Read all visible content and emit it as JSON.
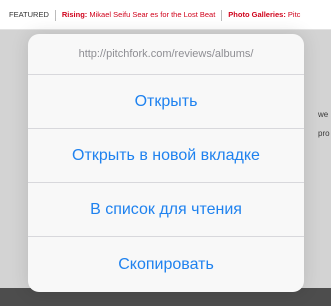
{
  "background": {
    "featured_label": "FEATURED",
    "rising_label": "Rising:",
    "rising_story": "Mikael Seifu Sear  es for the Lost Beat",
    "galleries_label": "Photo Galleries:",
    "galleries_story": "Pitc",
    "snippet_1": "we",
    "snippet_2": "pro"
  },
  "sheet": {
    "url": "http://pitchfork.com/reviews/albums/",
    "actions": [
      {
        "label": "Открыть"
      },
      {
        "label": "Открыть в новой вкладке"
      },
      {
        "label": "В список для чтения"
      },
      {
        "label": "Скопировать"
      }
    ]
  },
  "colors": {
    "accent": "#1f82ef",
    "header_text": "#8e8e93",
    "featured_red": "#d0021b"
  }
}
